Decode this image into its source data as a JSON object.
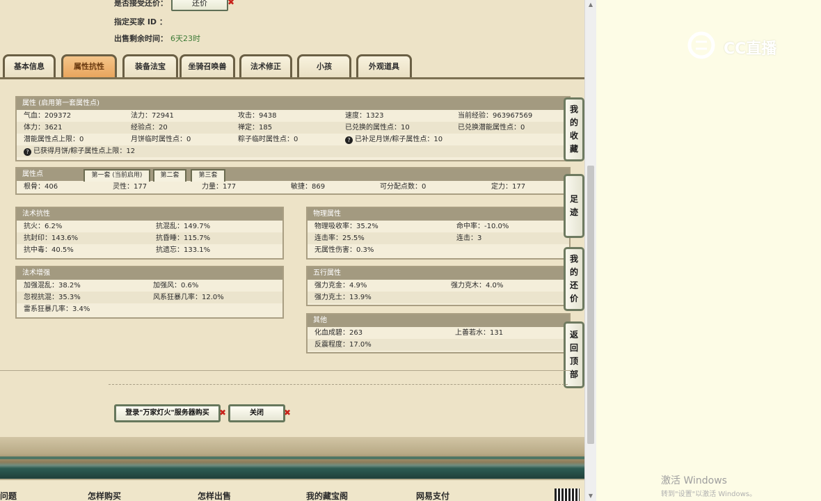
{
  "top": {
    "counter_label": "是否接受还价：",
    "counter_button": "还价",
    "buyer_label": "指定买家 ID ：",
    "remaining_label": "出售剩余时间：",
    "remaining_value": "6天23时"
  },
  "tabs": [
    "基本信息",
    "属性抗性",
    "装备法宝",
    "坐骑召唤兽",
    "法术修正",
    "小孩",
    "外观道具"
  ],
  "attr_panel": {
    "title": "属性 (启用第一套属性点)",
    "rows": [
      [
        "气血：209372",
        "法力：72941",
        "攻击：9438",
        "速度：1323",
        "当前经验：963967569"
      ],
      [
        "体力：3621",
        "经验点：20",
        "禅定：185",
        "已兑换的属性点：10",
        "已兑换潜能属性点：0"
      ],
      [
        "潜能属性点上限：0",
        "月饼临时属性点：0",
        "粽子临时属性点：0",
        "已补足月饼/粽子属性点：10"
      ],
      [
        "已获得月饼/粽子属性点上限：12"
      ]
    ]
  },
  "points_panel": {
    "title": "属性点",
    "subtabs": [
      "第一套 (当前启用)",
      "第二套",
      "第三套"
    ],
    "row": [
      "根骨：406",
      "灵性：177",
      "力量：177",
      "敏捷：869",
      "可分配点数：0",
      "定力：177"
    ]
  },
  "resist_panel": {
    "title": "法术抗性",
    "rows": [
      [
        "抗火：6.2%",
        "抗混乱：149.7%"
      ],
      [
        "抗封印：143.6%",
        "抗昏睡：115.7%"
      ],
      [
        "抗中毒：40.5%",
        "抗遗忘：133.1%"
      ]
    ]
  },
  "enhance_panel": {
    "title": "法术增强",
    "rows": [
      [
        "加强混乱：38.2%",
        "加强风：0.6%"
      ],
      [
        "忽视抗混：35.3%",
        "风系狂暴几率：12.0%"
      ],
      [
        "雷系狂暴几率：3.4%"
      ]
    ]
  },
  "physical_panel": {
    "title": "物理属性",
    "rows": [
      [
        "物理吸收率：35.2%",
        "命中率：-10.0%"
      ],
      [
        "连击率：25.5%",
        "连击：3"
      ],
      [
        "无属性伤害：0.3%"
      ]
    ]
  },
  "elements_panel": {
    "title": "五行属性",
    "rows": [
      [
        "强力克金：4.9%",
        "强力克木：4.0%"
      ],
      [
        "强力克土：13.9%"
      ]
    ]
  },
  "other_panel": {
    "title": "其他",
    "rows": [
      [
        "化血成碧：263",
        "上善若水：131"
      ],
      [
        "反震程度：17.0%"
      ]
    ]
  },
  "side_buttons": [
    "我的收藏",
    "足迹",
    "我的还价",
    "返回顶部"
  ],
  "buttons": {
    "buy": "登录\"万家灯火\"服务器购买",
    "close": "关闭"
  },
  "footer": [
    "问题",
    "怎样购买",
    "怎样出售",
    "我的藏宝阁",
    "网易支付"
  ],
  "watermark": {
    "logo": "CC直播",
    "activate": "激活 Windows",
    "activate_sub": "转到\"设置\"以激活 Windows。"
  }
}
